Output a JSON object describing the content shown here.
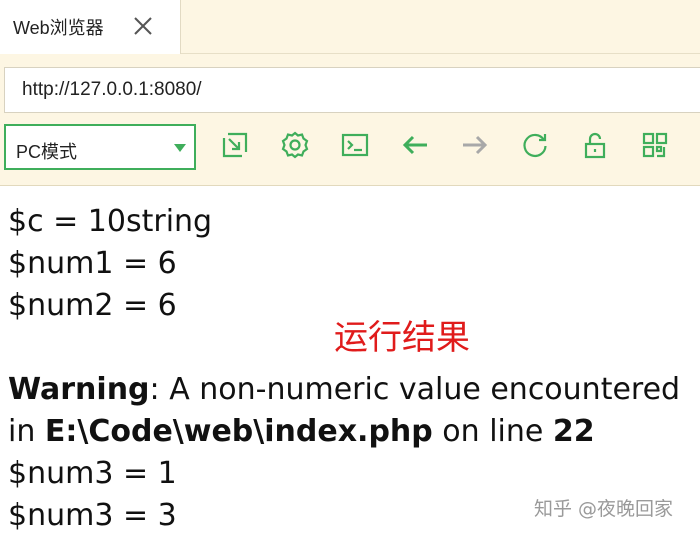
{
  "tab": {
    "title": "Web浏览器"
  },
  "address": {
    "url": "http://127.0.0.1:8080/"
  },
  "toolbar": {
    "mode_selected": "PC模式",
    "accent_color": "#3fae5b",
    "disabled_color": "#a8a8a8",
    "buttons": [
      {
        "id": "open-external",
        "icon": "external-open-icon"
      },
      {
        "id": "settings",
        "icon": "gear-icon"
      },
      {
        "id": "console",
        "icon": "terminal-icon"
      },
      {
        "id": "back",
        "icon": "arrow-left-icon"
      },
      {
        "id": "forward",
        "icon": "arrow-right-icon"
      },
      {
        "id": "refresh",
        "icon": "refresh-icon"
      },
      {
        "id": "lock",
        "icon": "unlock-icon"
      },
      {
        "id": "qr",
        "icon": "qr-code-icon"
      }
    ]
  },
  "content": {
    "line1": "$c = 10string",
    "line2": "$num1 = 6",
    "line3": "$num2 = 6",
    "warning_label": "Warning",
    "warning_text": ": A non-numeric value encountered",
    "warning_in": "in ",
    "warning_file": "E:\\Code\\web\\index.php",
    "warning_online": " on line ",
    "warning_line_no": "22",
    "line4": "$num3 = 1",
    "line5": "$num3 = 3"
  },
  "annotation": {
    "text": "运行结果",
    "color": "#e01b1b"
  },
  "watermark": {
    "text": "知乎 @夜晚回家"
  }
}
